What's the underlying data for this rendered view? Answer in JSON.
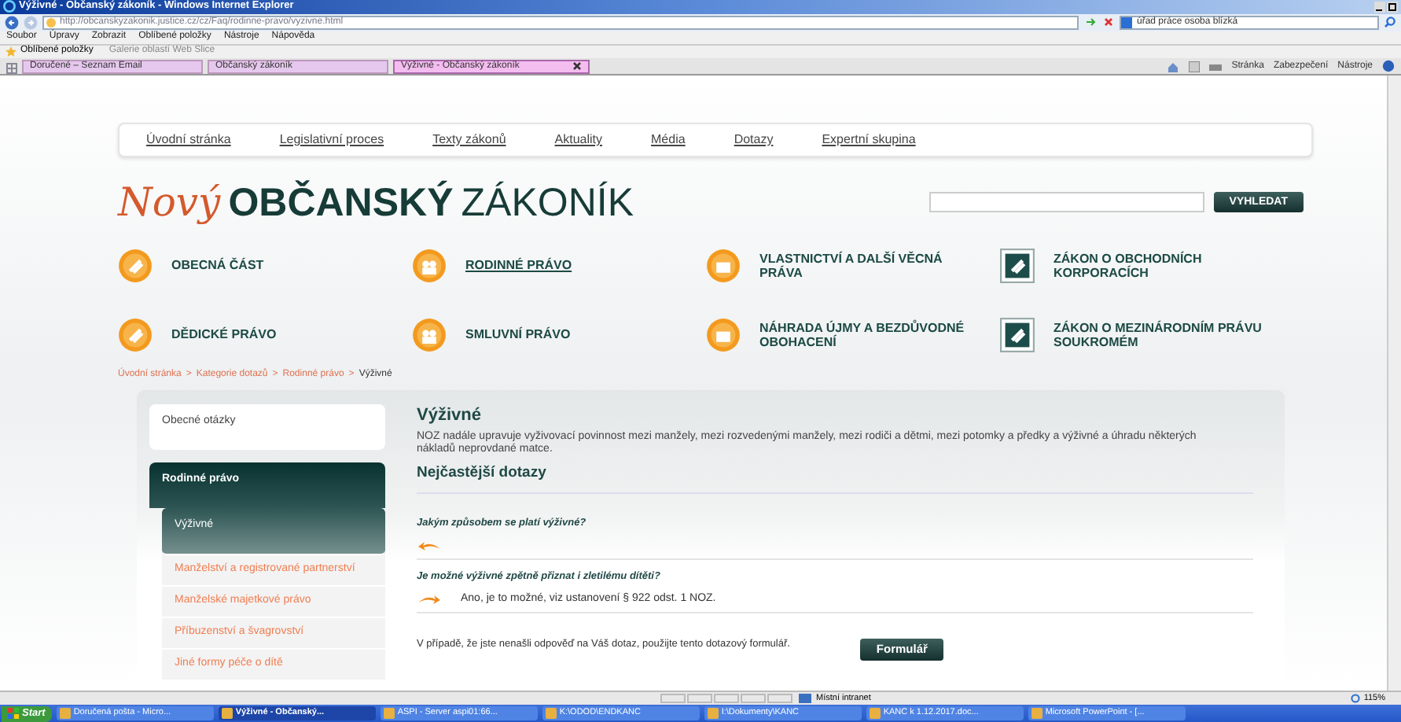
{
  "window": {
    "title": "Výživné - Občanský zákoník - Windows Internet Explorer"
  },
  "address_bar": {
    "url": "http://obcanskyzakonik.justice.cz/cz/Faq/rodinne-pravo/vyzivne.html"
  },
  "browser_search": {
    "value": "úřad práce osoba blízká"
  },
  "menu": [
    "Soubor",
    "Úpravy",
    "Zobrazit",
    "Oblíbené položky",
    "Nástroje",
    "Nápověda"
  ],
  "favorites_bar": {
    "label": "Oblíbené položky",
    "items": [
      "Galerie oblastí Web Slice"
    ]
  },
  "tabs": [
    {
      "label": "Doručené – Seznam Email",
      "selected": false
    },
    {
      "label": "Občanský zákoník",
      "selected": false
    },
    {
      "label": "Výživné - Občanský zákoník",
      "selected": true
    }
  ],
  "command_bar": [
    "Stránka",
    "Zabezpečení",
    "Nástroje"
  ],
  "site_nav": [
    "Úvodní stránka",
    "Legislativní proces",
    "Texty zákonů",
    "Aktuality",
    "Média",
    "Dotazy",
    "Expertní skupina"
  ],
  "logo": {
    "script": "Nový",
    "bold": "OBČANSKÝ",
    "regular": "ZÁKONÍK"
  },
  "site_search": {
    "button": "VYHLEDAT"
  },
  "categories": [
    {
      "label": "OBECNÁ ČÁST",
      "kind": "round",
      "selected": false
    },
    {
      "label": "RODINNÉ PRÁVO",
      "kind": "round",
      "selected": true
    },
    {
      "label": "VLASTNICTVÍ A DALŠÍ VĚCNÁ PRÁVA",
      "kind": "round",
      "selected": false
    },
    {
      "label": "ZÁKON O OBCHODNÍCH KORPORACÍCH",
      "kind": "square",
      "selected": false
    },
    {
      "label": "DĚDICKÉ PRÁVO",
      "kind": "round",
      "selected": false
    },
    {
      "label": "SMLUVNÍ PRÁVO",
      "kind": "round",
      "selected": false
    },
    {
      "label": "NÁHRADA ÚJMY A BEZDŮVODNÉ OBOHACENÍ",
      "kind": "round",
      "selected": false
    },
    {
      "label": "ZÁKON O MEZINÁRODNÍM PRÁVU SOUKROMÉM",
      "kind": "square",
      "selected": false
    }
  ],
  "breadcrumb": {
    "separator": ">",
    "items": [
      "Úvodní stránka",
      "Kategorie dotazů",
      "Rodinné právo",
      "Výživné"
    ]
  },
  "sidebar": {
    "items": [
      {
        "label": "Obecné otázky",
        "expanded": false
      },
      {
        "label": "Rodinné právo",
        "expanded": true,
        "children": [
          {
            "label": "Výživné",
            "selected": true
          },
          {
            "label": "Manželství a registrované partnerství",
            "selected": false
          },
          {
            "label": "Manželské majetkové právo",
            "selected": false
          },
          {
            "label": "Příbuzenství a švagrovství",
            "selected": false
          },
          {
            "label": "Jiné formy péče o dítě",
            "selected": false
          }
        ]
      }
    ]
  },
  "article": {
    "title": "Výživné",
    "text": "NOZ nadále upravuje vyživovací povinnost mezi manžely, mezi rozvedenými manžely, mezi rodiči a dětmi, mezi potomky a předky a výživné a úhradu některých nákladů neprovdané matce.",
    "faq_heading": "Nejčastější dotazy",
    "questions": [
      {
        "question": "Jakým způsobem se platí výživné?",
        "expanded": false
      },
      {
        "question": "Je možné výživné zpětně přiznat i zletilému dítěti?",
        "expanded": true,
        "answer": "Ano, je to možné, viz ustanovení § 922 odst. 1 NOZ."
      }
    ],
    "footer_text": "V případě, že jste nenašli odpověď na Váš dotaz, použijte tento dotazový formulář.",
    "button": "Formulář"
  },
  "status_bar": {
    "zone": "Místní intranet",
    "zoom": "115%"
  },
  "taskbar": {
    "start": "Start",
    "items": [
      {
        "label": "Doručená pošta - Micro...",
        "selected": false
      },
      {
        "label": "Výživné - Občanský...",
        "selected": true
      },
      {
        "label": "ASPI - Server aspi01:66...",
        "selected": false
      },
      {
        "label": "K:\\ODOD\\ENDKANC",
        "selected": false
      },
      {
        "label": "I:\\Dokumenty\\KANC",
        "selected": false
      },
      {
        "label": "KANC k 1.12.2017.doc...",
        "selected": false
      },
      {
        "label": "Microsoft PowerPoint - [...",
        "selected": false
      }
    ]
  }
}
